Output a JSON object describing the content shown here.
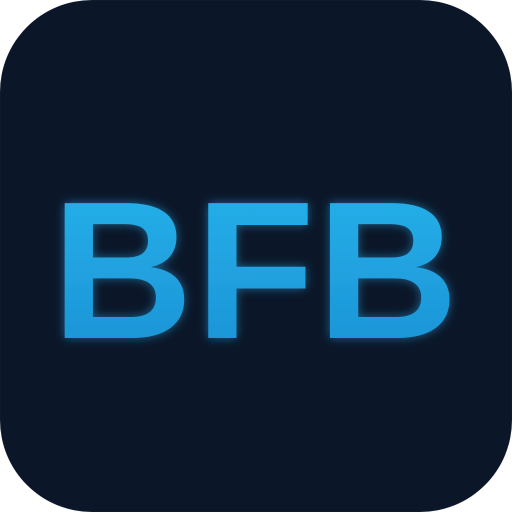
{
  "icon": {
    "label": "BFB",
    "background_color": "#0b1628",
    "text_color_top": "#27b4ec",
    "text_color_bottom": "#1a8fd3",
    "glow_color": "#2aa8e6"
  }
}
